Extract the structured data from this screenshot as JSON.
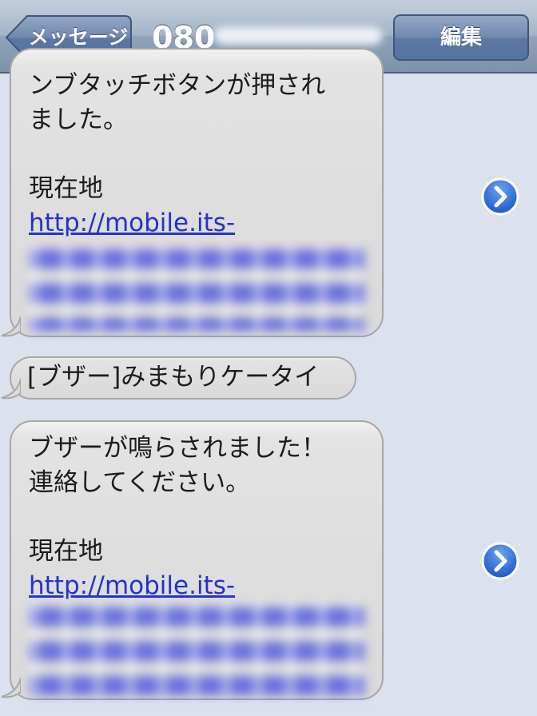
{
  "nav": {
    "back_label": "メッセージ",
    "title_prefix": "080",
    "edit_label": "編集"
  },
  "messages": [
    {
      "lines": [
        "ンブタッチボタンが押され",
        "ました。"
      ],
      "location_label": "現在地",
      "link_text": "http://mobile.its-"
    },
    {
      "lines": [
        "[ブザー]みまもりケータイ"
      ]
    },
    {
      "lines": [
        "ブザーが鳴らされました！",
        "連絡してください。"
      ],
      "location_label": "現在地",
      "link_text": "http://mobile.its-"
    }
  ],
  "colors": {
    "link": "#2332c9",
    "disclosure": "#2f6ed9"
  },
  "icons": [
    "back-arrow-icon",
    "disclosure-chevron-icon"
  ]
}
